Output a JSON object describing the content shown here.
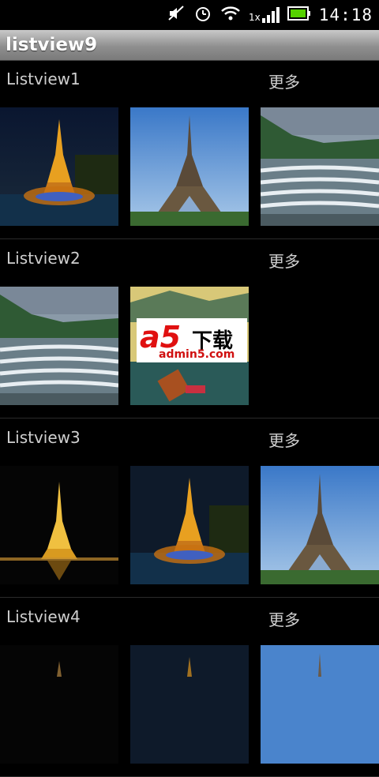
{
  "status": {
    "time": "14:18",
    "network": "1x"
  },
  "app": {
    "title": "listview9"
  },
  "sections": [
    {
      "title": "Listview1",
      "more": "更多"
    },
    {
      "title": "Listview2",
      "more": "更多"
    },
    {
      "title": "Listview3",
      "more": "更多"
    },
    {
      "title": "Listview4",
      "more": "更多"
    }
  ],
  "watermark": {
    "brand": "a5",
    "label": "下载",
    "site": "admin5.com"
  }
}
